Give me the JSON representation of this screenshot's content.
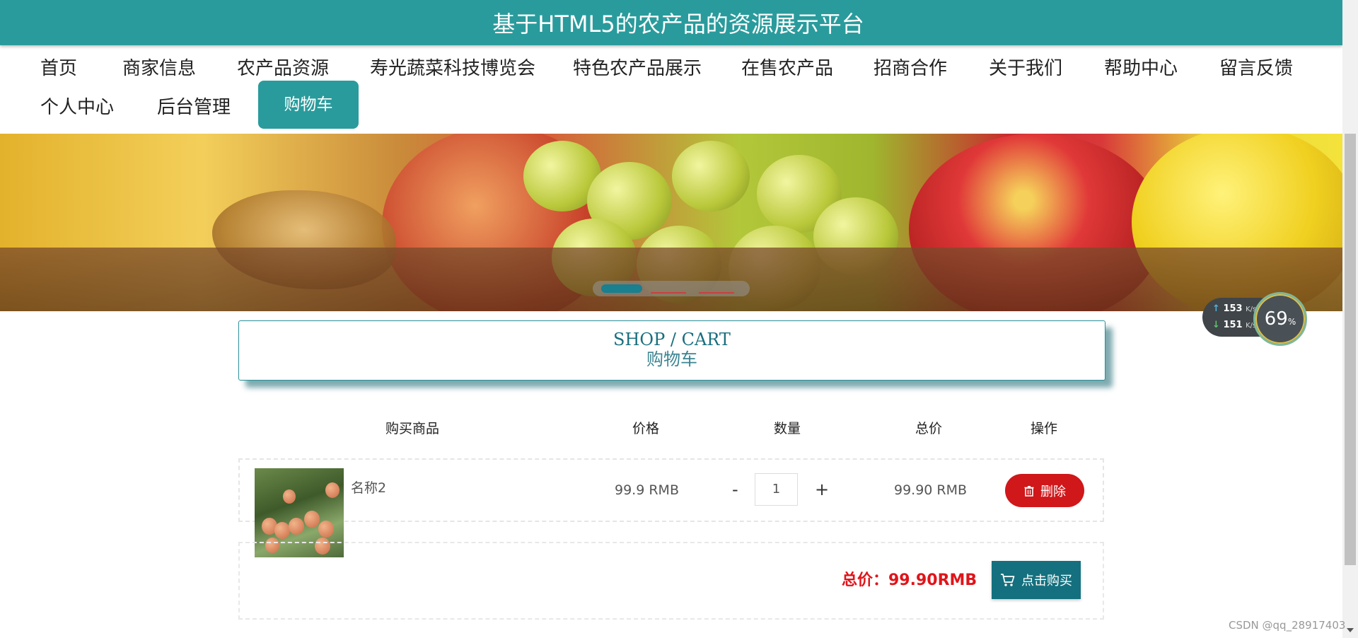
{
  "site": {
    "title": "基于HTML5的农产品的资源展示平台"
  },
  "nav": {
    "items": [
      {
        "label": "首页"
      },
      {
        "label": "商家信息"
      },
      {
        "label": "农产品资源"
      },
      {
        "label": "寿光蔬菜科技博览会"
      },
      {
        "label": "特色农产品展示"
      },
      {
        "label": "在售农产品"
      },
      {
        "label": "招商合作"
      },
      {
        "label": "关于我们"
      },
      {
        "label": "帮助中心"
      },
      {
        "label": "留言反馈"
      },
      {
        "label": "个人中心"
      },
      {
        "label": "后台管理"
      },
      {
        "label": "购物车"
      }
    ],
    "active": "购物车",
    "active_color": "#2a9b9c"
  },
  "speed_widget": {
    "upload": "153",
    "upload_unit": "K/s",
    "download": "151",
    "download_unit": "K/s",
    "percent": "69",
    "percent_unit": "%"
  },
  "section": {
    "title_en": "SHOP / CART",
    "title_cn": "购物车"
  },
  "cart": {
    "headers": {
      "product": "购买商品",
      "price": "价格",
      "quantity": "数量",
      "total": "总价",
      "action": "操作"
    },
    "items": [
      {
        "name": "名称2",
        "price": "99.9 RMB",
        "quantity": "1",
        "total": "99.90 RMB",
        "delete_label": "删除",
        "minus": "-",
        "plus": "+"
      }
    ],
    "grand_total": "总价：99.90RMB",
    "buy_label": "点击购买",
    "delete_color": "#d0171a",
    "buy_color": "#14707e"
  },
  "watermark": "CSDN @qq_28917403"
}
